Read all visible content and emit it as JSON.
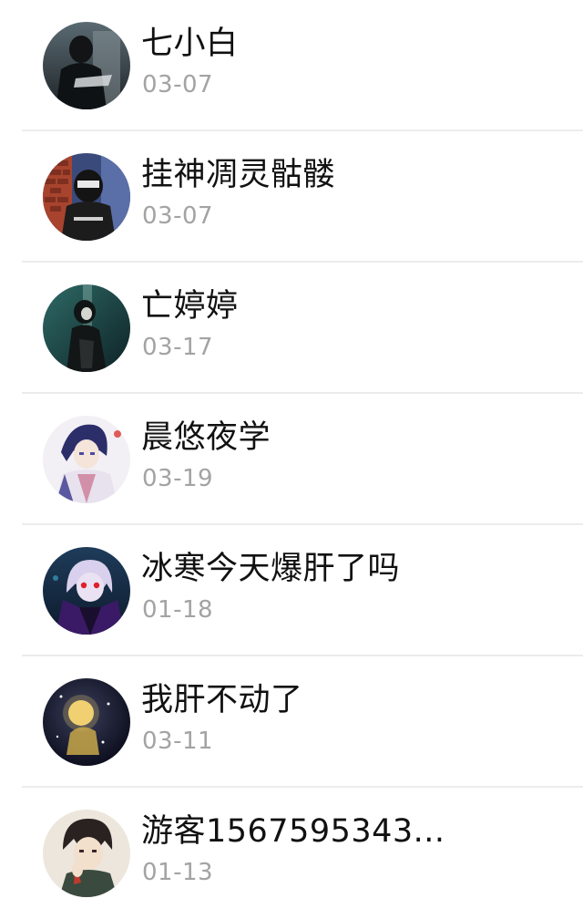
{
  "contacts": [
    {
      "name": "七小白",
      "date": "03-07",
      "avatar_icon": "dark-figure-avatar-icon"
    },
    {
      "name": "挂神凋灵骷髅",
      "date": "03-07",
      "avatar_icon": "masked-figure-avatar-icon"
    },
    {
      "name": "亡婷婷",
      "date": "03-17",
      "avatar_icon": "ghost-girl-avatar-icon"
    },
    {
      "name": "晨悠夜学",
      "date": "03-19",
      "avatar_icon": "anime-boy-avatar-icon"
    },
    {
      "name": "冰寒今天爆肝了吗",
      "date": "01-18",
      "avatar_icon": "red-eyed-character-avatar-icon"
    },
    {
      "name": "我肝不动了",
      "date": "03-11",
      "avatar_icon": "night-glow-avatar-icon"
    },
    {
      "name": "游客1567595343...",
      "date": "01-13",
      "avatar_icon": "anime-boy-sketch-avatar-icon"
    }
  ],
  "colors": {
    "name_text": "#111111",
    "date_text": "#a3a3a3",
    "divider": "#ececec",
    "background": "#ffffff"
  }
}
